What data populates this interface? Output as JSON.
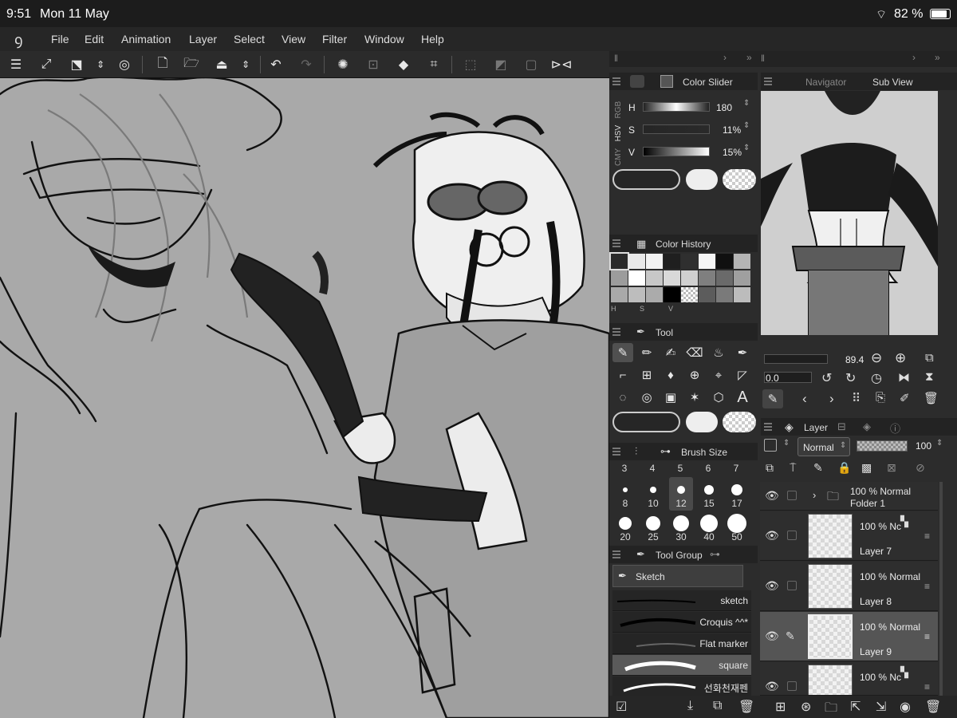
{
  "status": {
    "time": "9:51",
    "date": "Mon 11 May",
    "battery": "82 %"
  },
  "menu": [
    "File",
    "Edit",
    "Animation",
    "Layer",
    "Select",
    "View",
    "Filter",
    "Window",
    "Help"
  ],
  "color_slider": {
    "title": "Color Slider",
    "mode_tabs": [
      "RGB",
      "HSV",
      "CMY"
    ],
    "h": {
      "label": "H",
      "value": "180"
    },
    "s": {
      "label": "S",
      "value": "11%"
    },
    "v": {
      "label": "V",
      "value": "15%"
    }
  },
  "navigator": {
    "tab1": "Navigator",
    "tab2": "Sub View"
  },
  "color_history": {
    "title": "Color History",
    "hsv_labels": [
      "H",
      "S",
      "V"
    ],
    "swatches": [
      "#2a2a2a",
      "#e9e9e9",
      "#f3f3f3",
      "#1f1f1f",
      "#2f2f2f",
      "#f5f5f5",
      "#101010",
      "#b4b4b4",
      "#9c9c9c",
      "#ffffff",
      "#c7c7c7",
      "#d9d9d9",
      "#d0d0d0",
      "#7f7f7f",
      "#6a6a6a",
      "#9f9f9f",
      "#a9a9a9",
      "#bdbdbd",
      "#ababab",
      "#000000",
      "#checker",
      "#5c5c5c",
      "#7a7a7a",
      "#bcbcbc"
    ]
  },
  "nav_controls": {
    "zoom": "89.4",
    "angle": "0.0"
  },
  "tool": {
    "title": "Tool"
  },
  "brush_size": {
    "title": "Brush Size",
    "row1": [
      "3",
      "4",
      "5",
      "6",
      "7"
    ],
    "row2": [
      "8",
      "10",
      "12",
      "15",
      "17"
    ],
    "row3": [
      "20",
      "25",
      "30",
      "40",
      "50"
    ]
  },
  "layer": {
    "title": "Layer",
    "blend_mode": "Normal",
    "opacity": "100",
    "rows": [
      {
        "pct": "100 % Normal",
        "name": "Folder 1"
      },
      {
        "pct": "100 % Nc",
        "name": "Layer 7"
      },
      {
        "pct": "100 % Normal",
        "name": "Layer 8"
      },
      {
        "pct": "100 % Normal",
        "name": "Layer 9"
      },
      {
        "pct": "100 % Nc",
        "name": ""
      }
    ]
  },
  "tool_group": {
    "title": "Tool Group",
    "selected": "Sketch",
    "presets": [
      "sketch",
      "Croquis ^^*",
      "Flat marker",
      "square",
      "선화천재펜"
    ]
  }
}
